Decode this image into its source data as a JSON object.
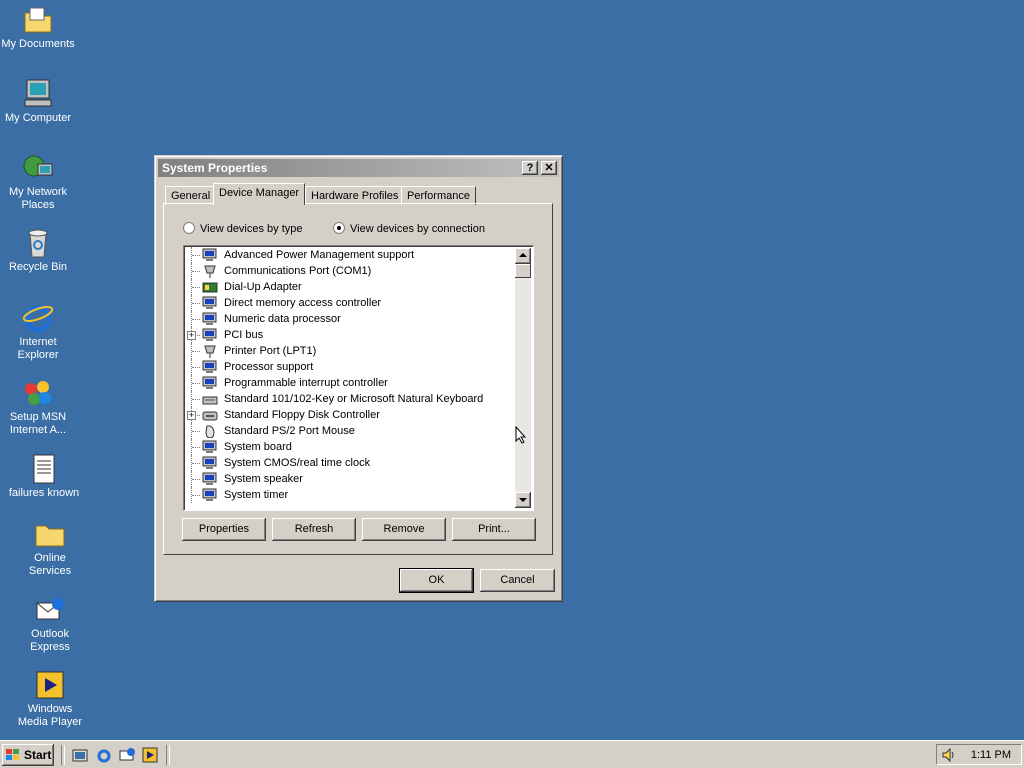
{
  "desktop": {
    "icons": [
      {
        "label": "My Documents",
        "icon": "folder-documents-icon"
      },
      {
        "label": "My Computer",
        "icon": "computer-icon"
      },
      {
        "label": "My Network Places",
        "icon": "network-icon"
      },
      {
        "label": "Recycle Bin",
        "icon": "recycle-bin-icon"
      },
      {
        "label": "Internet Explorer",
        "icon": "internet-explorer-icon"
      },
      {
        "label": "Setup MSN Internet A...",
        "icon": "msn-icon"
      },
      {
        "label": "failures known",
        "icon": "text-document-icon"
      },
      {
        "label": "Online Services",
        "icon": "folder-icon"
      },
      {
        "label": "Outlook Express",
        "icon": "outlook-express-icon"
      },
      {
        "label": "Windows Media Player",
        "icon": "media-player-icon"
      }
    ]
  },
  "dialog": {
    "title": "System Properties",
    "help_label": "?",
    "close_label": "✕",
    "tabs": [
      "General",
      "Device Manager",
      "Hardware Profiles",
      "Performance"
    ],
    "active_tab": "Device Manager",
    "radio_by_type": "View devices by type",
    "radio_by_connection": "View devices by connection",
    "selected_view": "View devices by connection",
    "devices": [
      {
        "label": "Advanced Power Management support",
        "icon": "computer-device-icon",
        "expandable": false
      },
      {
        "label": "Communications Port (COM1)",
        "icon": "port-icon",
        "expandable": false
      },
      {
        "label": "Dial-Up Adapter",
        "icon": "network-adapter-icon",
        "expandable": false
      },
      {
        "label": "Direct memory access controller",
        "icon": "computer-device-icon",
        "expandable": false
      },
      {
        "label": "Numeric data processor",
        "icon": "computer-device-icon",
        "expandable": false
      },
      {
        "label": "PCI bus",
        "icon": "computer-device-icon",
        "expandable": true
      },
      {
        "label": "Printer Port (LPT1)",
        "icon": "port-icon",
        "expandable": false
      },
      {
        "label": "Processor support",
        "icon": "computer-device-icon",
        "expandable": false
      },
      {
        "label": "Programmable interrupt controller",
        "icon": "computer-device-icon",
        "expandable": false
      },
      {
        "label": "Standard 101/102-Key or Microsoft Natural Keyboard",
        "icon": "keyboard-icon",
        "expandable": false
      },
      {
        "label": "Standard Floppy Disk Controller",
        "icon": "floppy-controller-icon",
        "expandable": true
      },
      {
        "label": "Standard PS/2 Port Mouse",
        "icon": "mouse-icon",
        "expandable": false
      },
      {
        "label": "System board",
        "icon": "computer-device-icon",
        "expandable": false
      },
      {
        "label": "System CMOS/real time clock",
        "icon": "computer-device-icon",
        "expandable": false
      },
      {
        "label": "System speaker",
        "icon": "computer-device-icon",
        "expandable": false
      },
      {
        "label": "System timer",
        "icon": "computer-device-icon",
        "expandable": false
      }
    ],
    "buttons": {
      "properties": "Properties",
      "refresh": "Refresh",
      "remove": "Remove",
      "print": "Print...",
      "ok": "OK",
      "cancel": "Cancel"
    }
  },
  "taskbar": {
    "start_label": "Start",
    "quick_launch": [
      "show-desktop-icon",
      "internet-explorer-icon",
      "outlook-express-icon",
      "media-player-icon"
    ],
    "clock": "1:11 PM",
    "tray_icons": [
      "volume-icon"
    ]
  },
  "colors": {
    "desktop": "#3a6ea5",
    "face": "#d4d0c8",
    "title_inactive": "#808080"
  }
}
